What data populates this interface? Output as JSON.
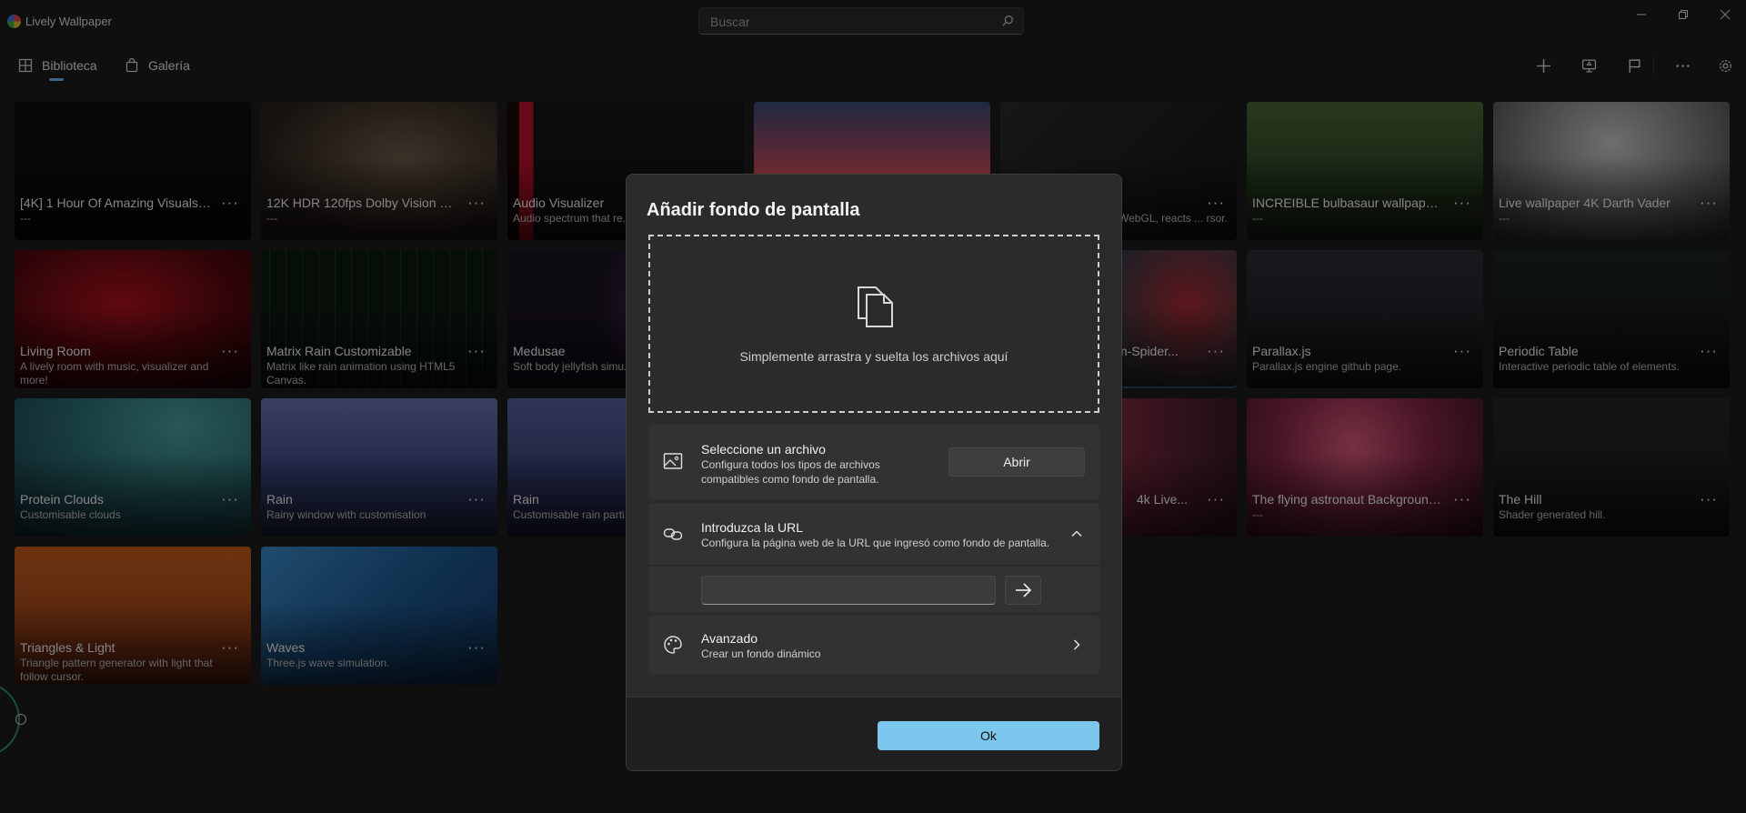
{
  "app": {
    "title": "Lively Wallpaper"
  },
  "search": {
    "placeholder": "Buscar"
  },
  "nav": {
    "library": "Biblioteca",
    "gallery": "Galería"
  },
  "tiles": [
    {
      "title": "[4K] 1 Hour Of Amazing Visuals -...",
      "desc": "---",
      "more": "···"
    },
    {
      "title": "12K HDR 120fps Dolby Vision wit...",
      "desc": "---",
      "more": "···"
    },
    {
      "title": "Audio Visualizer",
      "desc": "Audio spectrum that re... sound",
      "more": "···"
    },
    {
      "title": "",
      "desc": "",
      "more": ""
    },
    {
      "title": "",
      "desc": "WebGL, reacts ... rsor.",
      "more": "···"
    },
    {
      "title": "INCREIBLE bulbasaur wallpaper...",
      "desc": "---",
      "more": "···"
    },
    {
      "title": "Live wallpaper 4K Darth Vader",
      "desc": "---",
      "more": "···"
    },
    {
      "title": "Living Room",
      "desc": "A lively room with music, visualizer and more!",
      "more": "···"
    },
    {
      "title": "Matrix Rain Customizable",
      "desc": "Matrix like rain animation using HTML5 Canvas.",
      "more": "···"
    },
    {
      "title": "Medusae",
      "desc": "Soft body jellyfish simu...",
      "more": ""
    },
    {
      "title": "",
      "desc": "",
      "more": ""
    },
    {
      "title": "m-Spider...",
      "desc": "",
      "more": "···"
    },
    {
      "title": "Parallax.js",
      "desc": "Parallax.js engine github page.",
      "more": "···"
    },
    {
      "title": "Periodic Table",
      "desc": "Interactive periodic table of elements.",
      "more": "···"
    },
    {
      "title": "Protein Clouds",
      "desc": "Customisable clouds",
      "more": "···"
    },
    {
      "title": "Rain",
      "desc": "Rainy window with customisation",
      "more": "···"
    },
    {
      "title": "Rain",
      "desc": "Customisable rain parti...",
      "more": ""
    },
    {
      "title": "",
      "desc": "",
      "more": ""
    },
    {
      "title": "4k Live...",
      "desc": "",
      "more": "···"
    },
    {
      "title": "The flying astronaut Background...",
      "desc": "---",
      "more": "···"
    },
    {
      "title": "The Hill",
      "desc": "Shader generated hill.",
      "more": "···"
    },
    {
      "title": "Triangles & Light",
      "desc": "Triangle pattern generator with light that follow cursor.",
      "more": "···"
    },
    {
      "title": "Waves",
      "desc": "Three.js wave simulation.",
      "more": "···"
    }
  ],
  "dialog": {
    "title": "Añadir fondo de pantalla",
    "drop_text": "Simplemente arrastra y suelta los archivos aquí",
    "file": {
      "title": "Seleccione un archivo",
      "desc": "Configura todos los tipos de archivos compatibles como fondo de pantalla.",
      "button": "Abrir"
    },
    "url": {
      "title": "Introduzca la URL",
      "desc": "Configura la página web de la URL que ingresó como fondo de pantalla.",
      "value": ""
    },
    "advanced": {
      "title": "Avanzado",
      "desc": "Crear un fondo dinámico"
    },
    "ok": "Ok"
  },
  "colors": {
    "accent": "#7cc7ee",
    "selection": "#76b9ed",
    "dialog_bg": "#2b2b2b"
  }
}
